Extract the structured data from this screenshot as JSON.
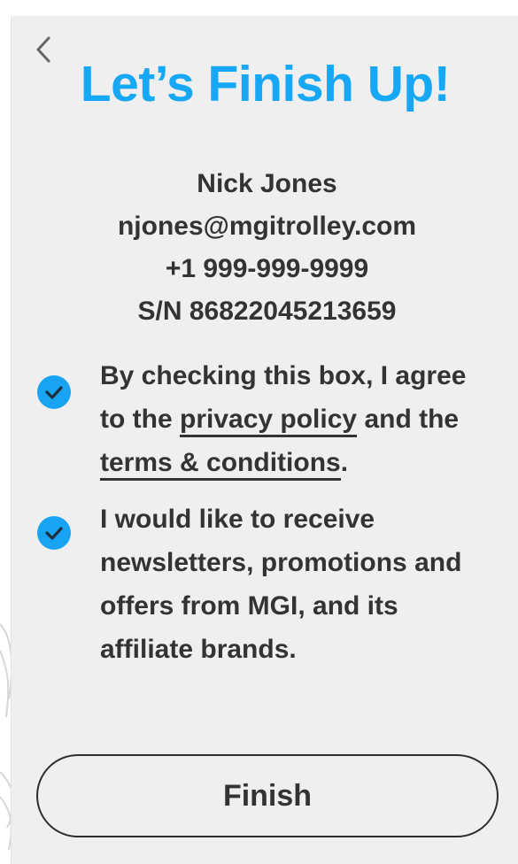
{
  "screen": {
    "title": "Let’s Finish Up!",
    "back_icon": "chevron-left-icon"
  },
  "user": {
    "name": "Nick Jones",
    "email": "njones@mgitrolley.com",
    "phone": "+1 999-999-9999",
    "serial": "S/N 86822045213659"
  },
  "consents": {
    "privacy": {
      "checked": true,
      "line1": "By checking this box, I agree",
      "line2_prefix": "to the ",
      "privacy_link": "privacy policy",
      "line2_suffix": " and the",
      "terms_link": "terms & conditions",
      "line3_suffix": "."
    },
    "newsletter": {
      "checked": true,
      "line1": "I would like to receive",
      "line2": "newsletters, promotions and",
      "line3": "offers from MGI, and its",
      "line4": "affiliate brands."
    }
  },
  "actions": {
    "finish_label": "Finish"
  },
  "colors": {
    "accent": "#16a8f5",
    "text": "#333333",
    "background": "#efefef"
  }
}
